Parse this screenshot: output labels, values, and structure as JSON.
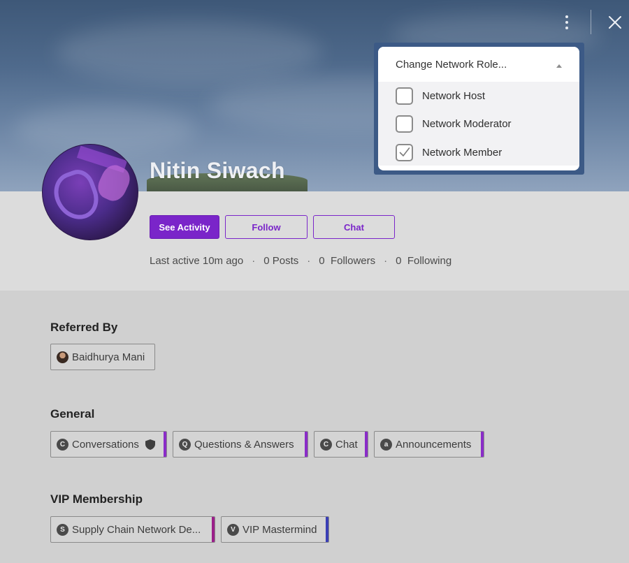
{
  "profile": {
    "name": "Nitin Siwach",
    "actions": {
      "see_activity": "See Activity",
      "follow": "Follow",
      "chat": "Chat"
    },
    "stats": {
      "last_active": "Last active 10m ago",
      "separator": "·",
      "posts": "0 Posts",
      "followers": "0  Followers",
      "following": "0  Following"
    }
  },
  "sections": {
    "referred_by": {
      "title": "Referred By",
      "person": "Baidhurya Mani"
    },
    "general": {
      "title": "General",
      "spaces": [
        {
          "icon_letter": "C",
          "label": "Conversations",
          "accent": "#8a2cc8"
        },
        {
          "icon_letter": "Q",
          "label": "Questions & Answers",
          "accent": "#8a2cc8"
        },
        {
          "icon_letter": "C",
          "label": "Chat",
          "accent": "#8a2cc8"
        },
        {
          "icon_letter": "a",
          "label": "Announcements",
          "accent": "#8a2cc8"
        }
      ]
    },
    "vip": {
      "title": "VIP Membership",
      "spaces": [
        {
          "icon_letter": "S",
          "label": "Supply Chain Network De...",
          "accent": "#9b1f8a"
        },
        {
          "icon_letter": "V",
          "label": "VIP Mastermind",
          "accent": "#3a3fb5"
        }
      ]
    }
  },
  "role_dropdown": {
    "header": "Change Network Role...",
    "options": [
      {
        "label": "Network Host",
        "checked": false
      },
      {
        "label": "Network Moderator",
        "checked": false
      },
      {
        "label": "Network Member",
        "checked": true
      }
    ]
  },
  "colors": {
    "accent_purple": "#7a25c9",
    "dropdown_frame": "#3c5a86"
  },
  "icons": [
    "more-vertical-icon",
    "close-icon",
    "caret-up-icon",
    "shield-icon",
    "checkmark-icon"
  ]
}
